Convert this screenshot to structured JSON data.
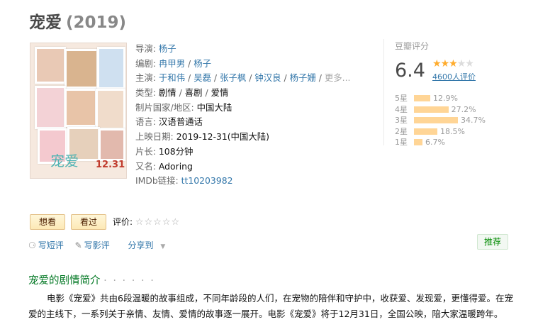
{
  "movie": {
    "title": "宠爱",
    "year": "(2019)"
  },
  "poster": {
    "logo": "宠爱",
    "date": "12.31"
  },
  "info": {
    "director": {
      "label": "导演:",
      "names": [
        "杨子"
      ]
    },
    "writer": {
      "label": "编剧:",
      "names": [
        "冉甲男",
        "杨子"
      ]
    },
    "cast": {
      "label": "主演:",
      "names": [
        "于和伟",
        "吴磊",
        "张子枫",
        "钟汉良",
        "杨子姗"
      ],
      "more": "更多..."
    },
    "genre": {
      "label": "类型:",
      "values": [
        "剧情",
        "喜剧",
        "爱情"
      ]
    },
    "country": {
      "label": "制片国家/地区:",
      "value": "中国大陆"
    },
    "language": {
      "label": "语言:",
      "value": "汉语普通话"
    },
    "release": {
      "label": "上映日期:",
      "value": "2019-12-31(中国大陆)"
    },
    "runtime": {
      "label": "片长:",
      "value": "108分钟"
    },
    "aka": {
      "label": "又名:",
      "value": "Adoring"
    },
    "imdb": {
      "label": "IMDb链接:",
      "value": "tt10203982"
    }
  },
  "rating": {
    "header": "豆瓣评分",
    "score": "6.4",
    "stars_filled": 3,
    "stars_total": 5,
    "count": "4600人评价",
    "bar_color": "#ffd596",
    "distribution": [
      {
        "label": "5星",
        "pct": "12.9%",
        "value": 12.9
      },
      {
        "label": "4星",
        "pct": "27.2%",
        "value": 27.2
      },
      {
        "label": "3星",
        "pct": "34.7%",
        "value": 34.7
      },
      {
        "label": "2星",
        "pct": "18.5%",
        "value": 18.5
      },
      {
        "label": "1星",
        "pct": "6.7%",
        "value": 6.7
      }
    ]
  },
  "interest": {
    "want_label": "想看",
    "seen_label": "看过",
    "rate_label": "评价:",
    "rate_stars": "☆☆☆☆☆"
  },
  "actions": {
    "short_review": "写短评",
    "review": "写影评",
    "share": "分享到",
    "recommend": "推荐"
  },
  "summary": {
    "title": "宠爱的剧情简介",
    "dots": "· · · · · ·",
    "text": "电影《宠爱》共由6段温暖的故事组成，不同年龄段的人们，在宠物的陪伴和守护中，收获爱、发现爱，更懂得爱。在宠爱的主线下，一系列关于亲情、友情、爱情的故事逐一展开。电影《宠爱》将于12月31日，全国公映，陪大家温暖跨年。"
  },
  "colors": {
    "link": "#3377aa",
    "star": "#ffac2d",
    "green": "#007722"
  }
}
